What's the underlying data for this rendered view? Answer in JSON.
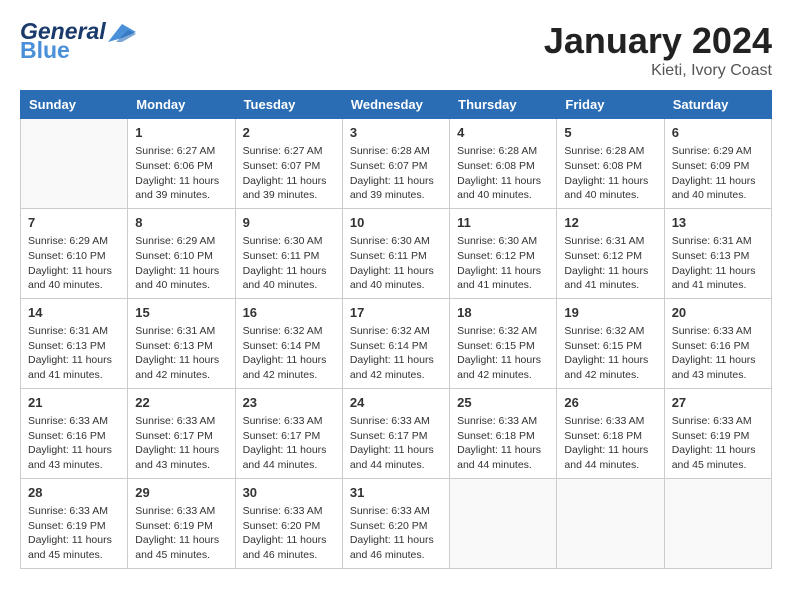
{
  "header": {
    "logo_line1": "General",
    "logo_line2": "Blue",
    "title": "January 2024",
    "subtitle": "Kieti, Ivory Coast"
  },
  "days_of_week": [
    "Sunday",
    "Monday",
    "Tuesday",
    "Wednesday",
    "Thursday",
    "Friday",
    "Saturday"
  ],
  "weeks": [
    [
      {
        "day": "",
        "info": ""
      },
      {
        "day": "1",
        "info": "Sunrise: 6:27 AM\nSunset: 6:06 PM\nDaylight: 11 hours\nand 39 minutes."
      },
      {
        "day": "2",
        "info": "Sunrise: 6:27 AM\nSunset: 6:07 PM\nDaylight: 11 hours\nand 39 minutes."
      },
      {
        "day": "3",
        "info": "Sunrise: 6:28 AM\nSunset: 6:07 PM\nDaylight: 11 hours\nand 39 minutes."
      },
      {
        "day": "4",
        "info": "Sunrise: 6:28 AM\nSunset: 6:08 PM\nDaylight: 11 hours\nand 40 minutes."
      },
      {
        "day": "5",
        "info": "Sunrise: 6:28 AM\nSunset: 6:08 PM\nDaylight: 11 hours\nand 40 minutes."
      },
      {
        "day": "6",
        "info": "Sunrise: 6:29 AM\nSunset: 6:09 PM\nDaylight: 11 hours\nand 40 minutes."
      }
    ],
    [
      {
        "day": "7",
        "info": "Sunrise: 6:29 AM\nSunset: 6:10 PM\nDaylight: 11 hours\nand 40 minutes."
      },
      {
        "day": "8",
        "info": "Sunrise: 6:29 AM\nSunset: 6:10 PM\nDaylight: 11 hours\nand 40 minutes."
      },
      {
        "day": "9",
        "info": "Sunrise: 6:30 AM\nSunset: 6:11 PM\nDaylight: 11 hours\nand 40 minutes."
      },
      {
        "day": "10",
        "info": "Sunrise: 6:30 AM\nSunset: 6:11 PM\nDaylight: 11 hours\nand 40 minutes."
      },
      {
        "day": "11",
        "info": "Sunrise: 6:30 AM\nSunset: 6:12 PM\nDaylight: 11 hours\nand 41 minutes."
      },
      {
        "day": "12",
        "info": "Sunrise: 6:31 AM\nSunset: 6:12 PM\nDaylight: 11 hours\nand 41 minutes."
      },
      {
        "day": "13",
        "info": "Sunrise: 6:31 AM\nSunset: 6:13 PM\nDaylight: 11 hours\nand 41 minutes."
      }
    ],
    [
      {
        "day": "14",
        "info": "Sunrise: 6:31 AM\nSunset: 6:13 PM\nDaylight: 11 hours\nand 41 minutes."
      },
      {
        "day": "15",
        "info": "Sunrise: 6:31 AM\nSunset: 6:13 PM\nDaylight: 11 hours\nand 42 minutes."
      },
      {
        "day": "16",
        "info": "Sunrise: 6:32 AM\nSunset: 6:14 PM\nDaylight: 11 hours\nand 42 minutes."
      },
      {
        "day": "17",
        "info": "Sunrise: 6:32 AM\nSunset: 6:14 PM\nDaylight: 11 hours\nand 42 minutes."
      },
      {
        "day": "18",
        "info": "Sunrise: 6:32 AM\nSunset: 6:15 PM\nDaylight: 11 hours\nand 42 minutes."
      },
      {
        "day": "19",
        "info": "Sunrise: 6:32 AM\nSunset: 6:15 PM\nDaylight: 11 hours\nand 42 minutes."
      },
      {
        "day": "20",
        "info": "Sunrise: 6:33 AM\nSunset: 6:16 PM\nDaylight: 11 hours\nand 43 minutes."
      }
    ],
    [
      {
        "day": "21",
        "info": "Sunrise: 6:33 AM\nSunset: 6:16 PM\nDaylight: 11 hours\nand 43 minutes."
      },
      {
        "day": "22",
        "info": "Sunrise: 6:33 AM\nSunset: 6:17 PM\nDaylight: 11 hours\nand 43 minutes."
      },
      {
        "day": "23",
        "info": "Sunrise: 6:33 AM\nSunset: 6:17 PM\nDaylight: 11 hours\nand 44 minutes."
      },
      {
        "day": "24",
        "info": "Sunrise: 6:33 AM\nSunset: 6:17 PM\nDaylight: 11 hours\nand 44 minutes."
      },
      {
        "day": "25",
        "info": "Sunrise: 6:33 AM\nSunset: 6:18 PM\nDaylight: 11 hours\nand 44 minutes."
      },
      {
        "day": "26",
        "info": "Sunrise: 6:33 AM\nSunset: 6:18 PM\nDaylight: 11 hours\nand 44 minutes."
      },
      {
        "day": "27",
        "info": "Sunrise: 6:33 AM\nSunset: 6:19 PM\nDaylight: 11 hours\nand 45 minutes."
      }
    ],
    [
      {
        "day": "28",
        "info": "Sunrise: 6:33 AM\nSunset: 6:19 PM\nDaylight: 11 hours\nand 45 minutes."
      },
      {
        "day": "29",
        "info": "Sunrise: 6:33 AM\nSunset: 6:19 PM\nDaylight: 11 hours\nand 45 minutes."
      },
      {
        "day": "30",
        "info": "Sunrise: 6:33 AM\nSunset: 6:20 PM\nDaylight: 11 hours\nand 46 minutes."
      },
      {
        "day": "31",
        "info": "Sunrise: 6:33 AM\nSunset: 6:20 PM\nDaylight: 11 hours\nand 46 minutes."
      },
      {
        "day": "",
        "info": ""
      },
      {
        "day": "",
        "info": ""
      },
      {
        "day": "",
        "info": ""
      }
    ]
  ]
}
